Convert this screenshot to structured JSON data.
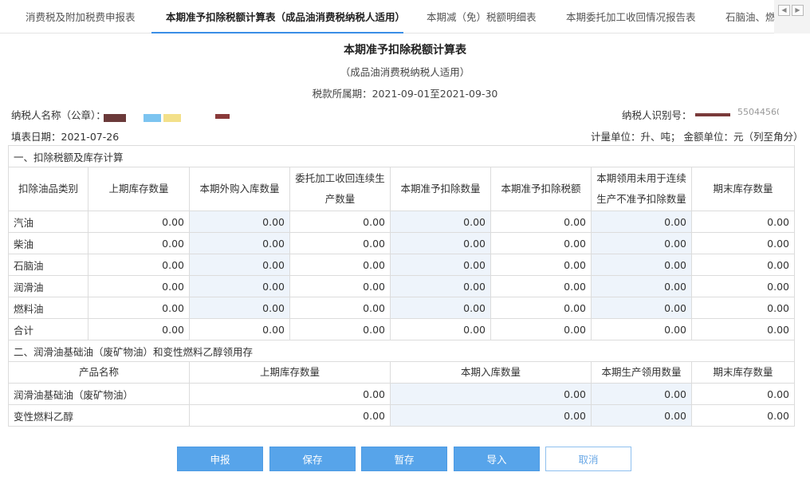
{
  "tabs": [
    {
      "label": "消费税及附加税费申报表",
      "active": false
    },
    {
      "label": "本期准予扣除税额计算表（成品油消费税纳税人适用）",
      "active": true
    },
    {
      "label": "本期减（免）税额明细表",
      "active": false
    },
    {
      "label": "本期委托加工收回情况报告表",
      "active": false
    },
    {
      "label": "石脑油、燃料",
      "active": false
    }
  ],
  "tab_nav": {
    "prev_icon": "◀",
    "next_icon": "▶"
  },
  "form": {
    "title": "本期准予扣除税额计算表",
    "subtitle": "（成品油消费税纳税人适用）",
    "period": "税款所属期：2021-09-01至2021-09-30",
    "taxpayer_name_label": "纳税人名称（公章）：",
    "taxpayer_id_label": "纳税人识别号：",
    "taxpayer_id_partial": "55044560",
    "fill_date": "填表日期：2021-07-26",
    "units": "计量单位：升、吨； 金额单位：元（列至角分）"
  },
  "section1": {
    "title": "一、扣除税额及库存计算",
    "headers": [
      "扣除油品类别",
      "上期库存数量",
      "本期外购入库数量",
      "委托加工收回连续生产数量",
      "本期准予扣除数量",
      "本期准予扣除税额",
      "本期领用未用于连续生产不准予扣除数量",
      "期末库存数量"
    ],
    "rows": [
      {
        "name": "汽油",
        "cells": [
          "0.00",
          "0.00",
          "0.00",
          "0.00",
          "0.00",
          "0.00",
          "0.00"
        ]
      },
      {
        "name": "柴油",
        "cells": [
          "0.00",
          "0.00",
          "0.00",
          "0.00",
          "0.00",
          "0.00",
          "0.00"
        ]
      },
      {
        "name": "石脑油",
        "cells": [
          "0.00",
          "0.00",
          "0.00",
          "0.00",
          "0.00",
          "0.00",
          "0.00"
        ]
      },
      {
        "name": "润滑油",
        "cells": [
          "0.00",
          "0.00",
          "0.00",
          "0.00",
          "0.00",
          "0.00",
          "0.00"
        ]
      },
      {
        "name": "燃料油",
        "cells": [
          "0.00",
          "0.00",
          "0.00",
          "0.00",
          "0.00",
          "0.00",
          "0.00"
        ]
      },
      {
        "name": "合计",
        "cells": [
          "0.00",
          "0.00",
          "0.00",
          "0.00",
          "0.00",
          "0.00",
          "0.00"
        ]
      }
    ]
  },
  "section2": {
    "title": "二、润滑油基础油（废矿物油）和变性燃料乙醇领用存",
    "headers": [
      "产品名称",
      "上期库存数量",
      "本期入库数量",
      "本期生产领用数量",
      "期末库存数量"
    ],
    "rows": [
      {
        "name": "润滑油基础油（废矿物油）",
        "cells": [
          "0.00",
          "0.00",
          "0.00",
          "0.00"
        ]
      },
      {
        "name": "变性燃料乙醇",
        "cells": [
          "0.00",
          "0.00",
          "0.00",
          "0.00"
        ]
      }
    ]
  },
  "buttons": {
    "submit": "申报",
    "save": "保存",
    "temp_save": "暂存",
    "import": "导入",
    "cancel": "取消"
  },
  "colors": {
    "accent": "#57a4ea",
    "editable_bg": "#eef4fb",
    "editable_text": "#2b7fd6",
    "border": "#dcdcdc"
  }
}
